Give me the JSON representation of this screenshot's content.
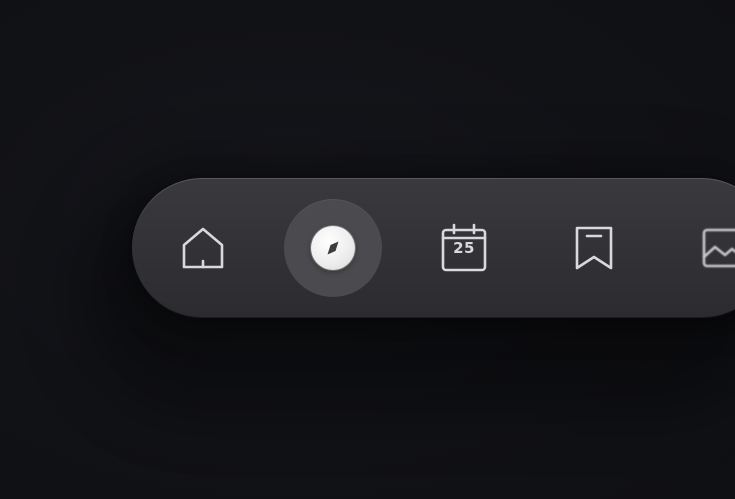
{
  "nav": {
    "items": [
      {
        "id": "home",
        "icon": "home-icon",
        "active": false
      },
      {
        "id": "explore",
        "icon": "compass-icon",
        "active": true
      },
      {
        "id": "calendar",
        "icon": "calendar-icon",
        "active": false,
        "day": "25"
      },
      {
        "id": "saved",
        "icon": "bookmark-icon",
        "active": false
      },
      {
        "id": "gallery",
        "icon": "image-icon",
        "active": false
      }
    ]
  },
  "colors": {
    "background": "#111216",
    "bar": "#333337",
    "active_bg": "#4b4b4f",
    "icon": "#d9d9dc"
  }
}
